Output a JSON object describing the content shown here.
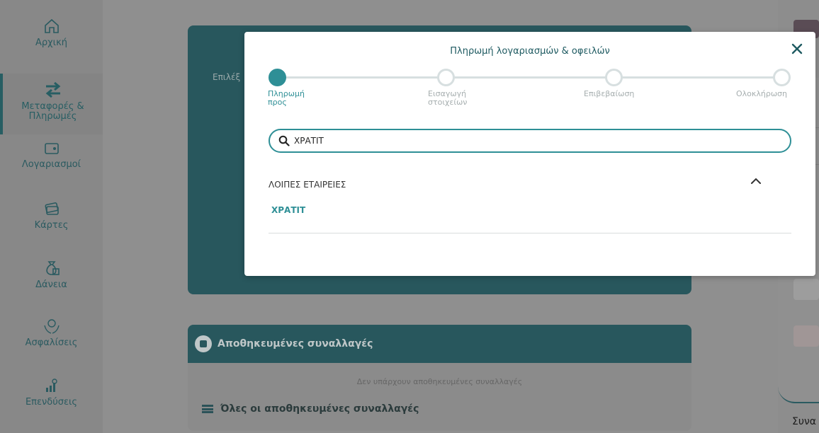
{
  "sidebar": {
    "items": [
      {
        "label": "Αρχική",
        "icon": "home-icon"
      },
      {
        "label": "Μεταφορές & Πληρωμές",
        "icon": "transfer-arrows-icon",
        "active": true
      },
      {
        "label": "Λογαριασμοί",
        "icon": "wallet-icon"
      },
      {
        "label": "Κάρτες",
        "icon": "cards-icon"
      },
      {
        "label": "Δάνεια",
        "icon": "money-bag-icon"
      },
      {
        "label": "Ασφαλίσεις",
        "icon": "insurance-hands-icon"
      },
      {
        "label": "Επενδύσεις",
        "icon": "investments-icon"
      }
    ]
  },
  "background": {
    "card_text": "Επιλέξ",
    "saved": {
      "title": "Αποθηκευμένες συναλλαγές",
      "empty_text": "Δεν υπάρχουν αποθηκευμένες συναλλαγές",
      "all_link": "Όλες οι αποθηκευμένες συναλλαγές"
    },
    "right_col_text": "Συνα"
  },
  "modal": {
    "title": "Πληρωμή λογαριασμών & οφειλών",
    "steps": [
      {
        "label_line1": "Πληρωμή",
        "label_line2": "προς",
        "active": true
      },
      {
        "label_line1": "Εισαγωγή",
        "label_line2": "στοιχείων",
        "active": false
      },
      {
        "label_line1": "Επιβεβαίωση",
        "label_line2": "",
        "active": false
      },
      {
        "label_line1": "Ολοκλήρωση",
        "label_line2": "",
        "active": false
      }
    ],
    "search": {
      "value": "ΧΡΑΤΙΤ",
      "icon": "search-icon"
    },
    "group_title": "ΛΟΙΠΕΣ ΕΤΑΙΡΕΙΕΣ",
    "results": [
      "ΧΡΑΤΙΤ"
    ]
  },
  "colors": {
    "accent": "#2e8f96",
    "dark_teal": "#28575d",
    "overlay_gray": "#8f8f8f"
  }
}
